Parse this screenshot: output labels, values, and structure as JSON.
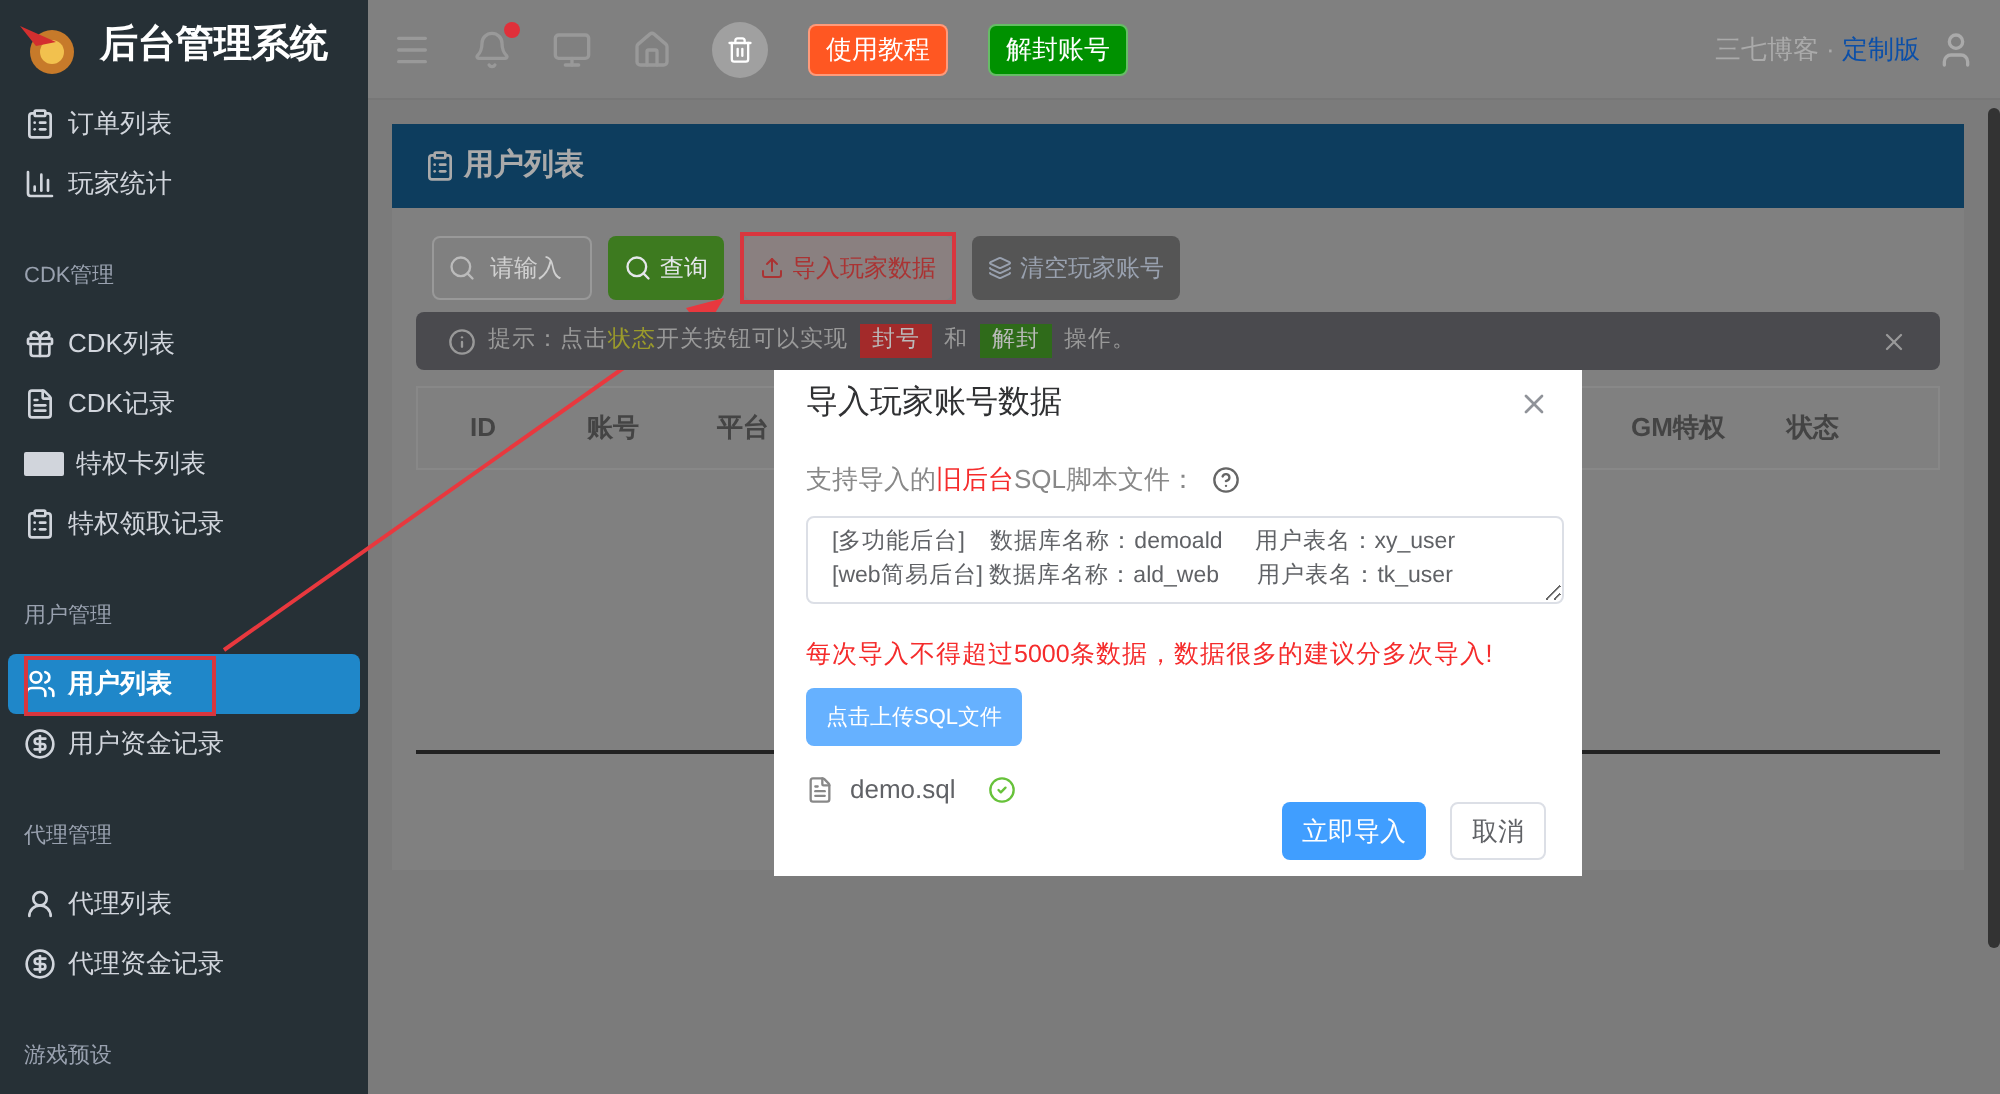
{
  "app": {
    "title": "后台管理系统"
  },
  "sidebar": {
    "groups": [
      {
        "items": [
          {
            "label": "订单列表",
            "selected": false
          },
          {
            "label": "玩家统计",
            "selected": false
          }
        ]
      },
      {
        "heading": "CDK管理",
        "items": [
          {
            "label": "CDK列表",
            "selected": false
          },
          {
            "label": "CDK记录",
            "selected": false
          },
          {
            "label": "特权卡列表",
            "selected": false
          },
          {
            "label": "特权领取记录",
            "selected": false
          }
        ]
      },
      {
        "heading": "用户管理",
        "items": [
          {
            "label": "用户列表",
            "selected": true
          },
          {
            "label": "用户资金记录",
            "selected": false
          }
        ]
      },
      {
        "heading": "代理管理",
        "items": [
          {
            "label": "代理列表",
            "selected": false
          },
          {
            "label": "代理资金记录",
            "selected": false
          }
        ]
      },
      {
        "heading": "游戏预设"
      }
    ]
  },
  "topbar": {
    "notification_dot": true,
    "buttons": [
      {
        "label": "使用教程",
        "color": "#ff5722"
      },
      {
        "label": "解封账号",
        "color": "#009100"
      }
    ],
    "site": "三七博客 · ",
    "edition": "定制版"
  },
  "page": {
    "title": "用户列表",
    "search": {
      "placeholder": "请输入"
    },
    "actions": [
      {
        "label": "查询",
        "kind": "query"
      },
      {
        "label": "导入玩家数据",
        "kind": "import"
      },
      {
        "label": "清空玩家账号",
        "kind": "clear"
      }
    ],
    "tip": [
      {
        "kind": "text",
        "text": "提示：点击**状态**开关按钮可以实现"
      },
      {
        "kind": "tag",
        "text": "封号",
        "color": "#a32a2a"
      },
      {
        "kind": "text",
        "text": "和"
      },
      {
        "kind": "tag",
        "text": "解封",
        "color": "#2f6b1a"
      },
      {
        "kind": "text",
        "text": "操作。"
      }
    ],
    "table": {
      "columns": [
        "ID",
        "账号",
        "平台",
        "GM特权",
        "状态"
      ]
    }
  },
  "dialog": {
    "title": "导入玩家账号数据",
    "label": "支持导入的**旧后台**SQL脚本文件：",
    "script_lines": [
      "[多功能后台]    数据库名称：demoald     用户表名：xy_user",
      "[web简易后台] 数据库名称：ald_web      用户表名：tk_user"
    ],
    "warning": "每次导入不得超过5000条数据，数据很多的建议分多次导入!",
    "upload_button": "点击上传SQL文件",
    "file": {
      "name": "demo.sql",
      "uploaded": true
    },
    "buttons": [
      {
        "label": "立即导入",
        "kind": "primary"
      },
      {
        "label": "取消",
        "kind": "secondary"
      }
    ]
  },
  "annotations": {
    "arrow": true,
    "highlights": true
  }
}
